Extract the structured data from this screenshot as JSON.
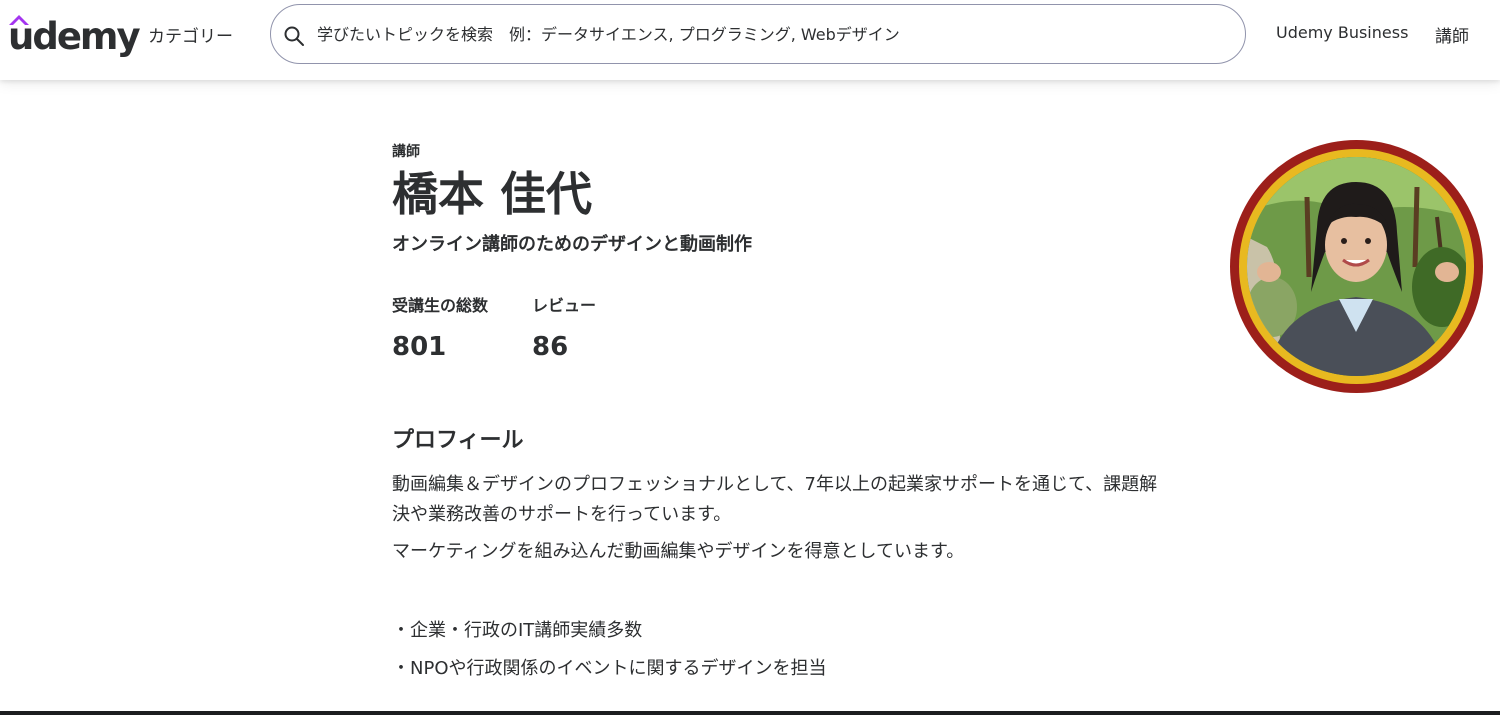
{
  "header": {
    "logo_text": "udemy",
    "categories_label": "カテゴリー",
    "search_placeholder": "学びたいトピックを検索　例：データサイエンス, プログラミング, Webデザイン",
    "business_label": "Udemy Business",
    "instructor_label": "講師"
  },
  "profile": {
    "role_label": "講師",
    "name": "橋本 佳代",
    "headline": "オンライン講師のためのデザインと動画制作",
    "stats": [
      {
        "label": "受講生の総数",
        "value": "801"
      },
      {
        "label": "レビュー",
        "value": "86"
      }
    ],
    "section_title": "プロフィール",
    "bio": [
      "動画編集＆デザインのプロフェッショナルとして、7年以上の起業家サポートを通じて、課題解決や業務改善のサポートを行っています。",
      "マーケティングを組み込んだ動画編集やデザインを得意としています。"
    ],
    "bullets": [
      "・企業・行政のIT講師実績多数",
      "・NPOや行政関係のイベントに関するデザインを担当"
    ]
  },
  "colors": {
    "text": "#2d2f31",
    "logo_accent": "#a435f0",
    "avatar_outer_ring": "#9c1f1a",
    "avatar_inner_ring": "#e8b920",
    "search_border": "#9194ac"
  },
  "icons": {
    "search": "search-icon",
    "logo_hat": "logo-hat-icon"
  }
}
